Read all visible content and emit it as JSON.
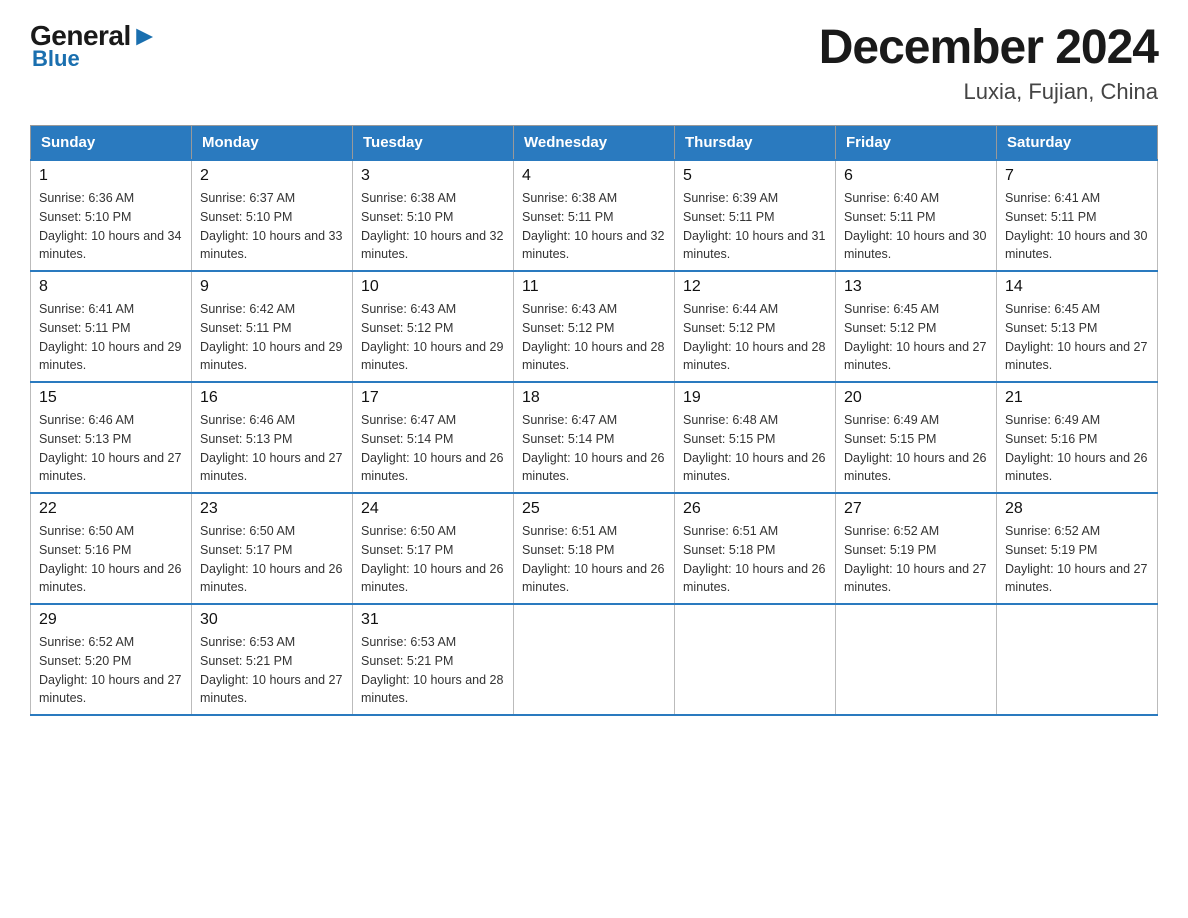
{
  "logo": {
    "general": "General",
    "blue": "Blue"
  },
  "title": "December 2024",
  "subtitle": "Luxia, Fujian, China",
  "days_header": [
    "Sunday",
    "Monday",
    "Tuesday",
    "Wednesday",
    "Thursday",
    "Friday",
    "Saturday"
  ],
  "weeks": [
    [
      {
        "day": "1",
        "sunrise": "6:36 AM",
        "sunset": "5:10 PM",
        "daylight": "10 hours and 34 minutes."
      },
      {
        "day": "2",
        "sunrise": "6:37 AM",
        "sunset": "5:10 PM",
        "daylight": "10 hours and 33 minutes."
      },
      {
        "day": "3",
        "sunrise": "6:38 AM",
        "sunset": "5:10 PM",
        "daylight": "10 hours and 32 minutes."
      },
      {
        "day": "4",
        "sunrise": "6:38 AM",
        "sunset": "5:11 PM",
        "daylight": "10 hours and 32 minutes."
      },
      {
        "day": "5",
        "sunrise": "6:39 AM",
        "sunset": "5:11 PM",
        "daylight": "10 hours and 31 minutes."
      },
      {
        "day": "6",
        "sunrise": "6:40 AM",
        "sunset": "5:11 PM",
        "daylight": "10 hours and 30 minutes."
      },
      {
        "day": "7",
        "sunrise": "6:41 AM",
        "sunset": "5:11 PM",
        "daylight": "10 hours and 30 minutes."
      }
    ],
    [
      {
        "day": "8",
        "sunrise": "6:41 AM",
        "sunset": "5:11 PM",
        "daylight": "10 hours and 29 minutes."
      },
      {
        "day": "9",
        "sunrise": "6:42 AM",
        "sunset": "5:11 PM",
        "daylight": "10 hours and 29 minutes."
      },
      {
        "day": "10",
        "sunrise": "6:43 AM",
        "sunset": "5:12 PM",
        "daylight": "10 hours and 29 minutes."
      },
      {
        "day": "11",
        "sunrise": "6:43 AM",
        "sunset": "5:12 PM",
        "daylight": "10 hours and 28 minutes."
      },
      {
        "day": "12",
        "sunrise": "6:44 AM",
        "sunset": "5:12 PM",
        "daylight": "10 hours and 28 minutes."
      },
      {
        "day": "13",
        "sunrise": "6:45 AM",
        "sunset": "5:12 PM",
        "daylight": "10 hours and 27 minutes."
      },
      {
        "day": "14",
        "sunrise": "6:45 AM",
        "sunset": "5:13 PM",
        "daylight": "10 hours and 27 minutes."
      }
    ],
    [
      {
        "day": "15",
        "sunrise": "6:46 AM",
        "sunset": "5:13 PM",
        "daylight": "10 hours and 27 minutes."
      },
      {
        "day": "16",
        "sunrise": "6:46 AM",
        "sunset": "5:13 PM",
        "daylight": "10 hours and 27 minutes."
      },
      {
        "day": "17",
        "sunrise": "6:47 AM",
        "sunset": "5:14 PM",
        "daylight": "10 hours and 26 minutes."
      },
      {
        "day": "18",
        "sunrise": "6:47 AM",
        "sunset": "5:14 PM",
        "daylight": "10 hours and 26 minutes."
      },
      {
        "day": "19",
        "sunrise": "6:48 AM",
        "sunset": "5:15 PM",
        "daylight": "10 hours and 26 minutes."
      },
      {
        "day": "20",
        "sunrise": "6:49 AM",
        "sunset": "5:15 PM",
        "daylight": "10 hours and 26 minutes."
      },
      {
        "day": "21",
        "sunrise": "6:49 AM",
        "sunset": "5:16 PM",
        "daylight": "10 hours and 26 minutes."
      }
    ],
    [
      {
        "day": "22",
        "sunrise": "6:50 AM",
        "sunset": "5:16 PM",
        "daylight": "10 hours and 26 minutes."
      },
      {
        "day": "23",
        "sunrise": "6:50 AM",
        "sunset": "5:17 PM",
        "daylight": "10 hours and 26 minutes."
      },
      {
        "day": "24",
        "sunrise": "6:50 AM",
        "sunset": "5:17 PM",
        "daylight": "10 hours and 26 minutes."
      },
      {
        "day": "25",
        "sunrise": "6:51 AM",
        "sunset": "5:18 PM",
        "daylight": "10 hours and 26 minutes."
      },
      {
        "day": "26",
        "sunrise": "6:51 AM",
        "sunset": "5:18 PM",
        "daylight": "10 hours and 26 minutes."
      },
      {
        "day": "27",
        "sunrise": "6:52 AM",
        "sunset": "5:19 PM",
        "daylight": "10 hours and 27 minutes."
      },
      {
        "day": "28",
        "sunrise": "6:52 AM",
        "sunset": "5:19 PM",
        "daylight": "10 hours and 27 minutes."
      }
    ],
    [
      {
        "day": "29",
        "sunrise": "6:52 AM",
        "sunset": "5:20 PM",
        "daylight": "10 hours and 27 minutes."
      },
      {
        "day": "30",
        "sunrise": "6:53 AM",
        "sunset": "5:21 PM",
        "daylight": "10 hours and 27 minutes."
      },
      {
        "day": "31",
        "sunrise": "6:53 AM",
        "sunset": "5:21 PM",
        "daylight": "10 hours and 28 minutes."
      },
      null,
      null,
      null,
      null
    ]
  ],
  "labels": {
    "sunrise": "Sunrise: ",
    "sunset": "Sunset: ",
    "daylight": "Daylight: "
  }
}
